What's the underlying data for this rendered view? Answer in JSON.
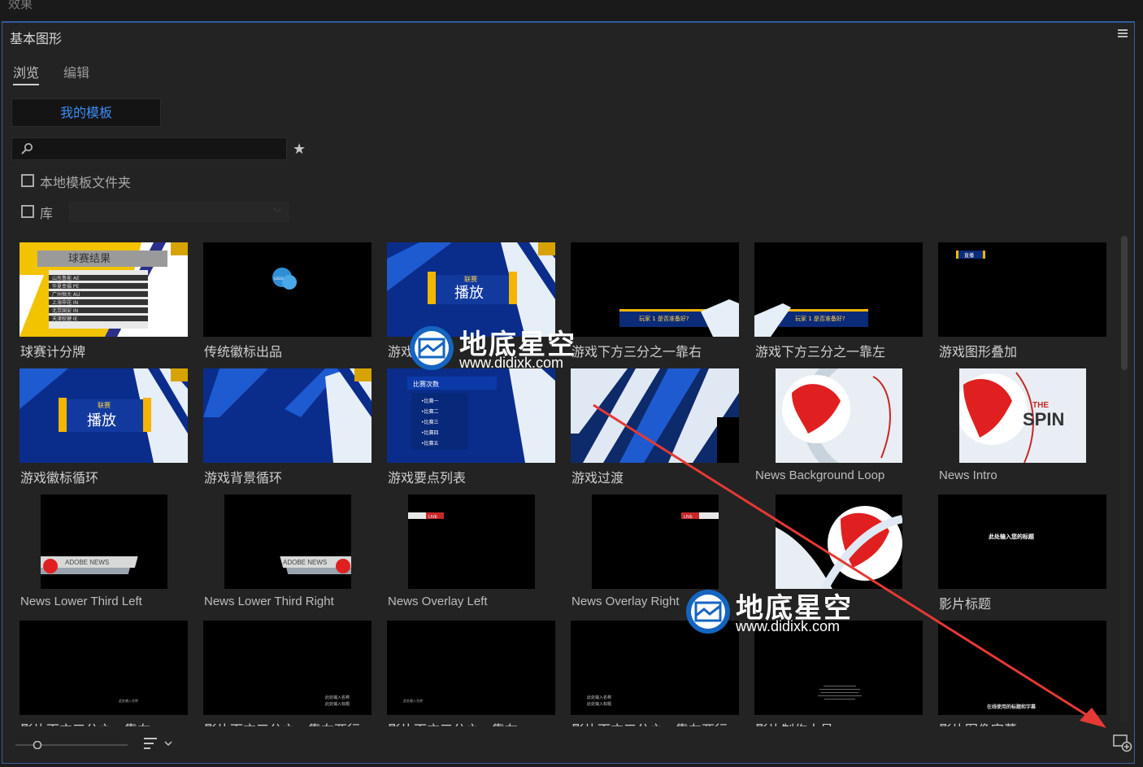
{
  "top_panel_title": "效果",
  "panel": {
    "title": "基本图形"
  },
  "tabs": [
    {
      "label": "浏览"
    },
    {
      "label": "编辑"
    }
  ],
  "my_templates_label": "我的模板",
  "search": {
    "placeholder": ""
  },
  "local_folder_label": "本地模板文件夹",
  "library_label": "库",
  "templates": [
    {
      "caption": "球赛计分牌",
      "thumb_text": [
        "球赛结果",
        "山东鲁能 AE",
        "华夏幸福 PE",
        "广州恒大 AU",
        "上海申花 IN",
        "北京国安 IN",
        "天津权健 IE"
      ]
    },
    {
      "caption": "传统徽标出品",
      "thumb_text": [
        "LOGO"
      ]
    },
    {
      "caption": "游戏徽标",
      "thumb_text": [
        "联赛",
        "播放"
      ]
    },
    {
      "caption": "游戏下方三分之一靠右",
      "thumb_text": [
        "玩家 1 是否准备好?"
      ]
    },
    {
      "caption": "游戏下方三分之一靠左",
      "thumb_text": [
        "玩家 1 是否准备好?"
      ]
    },
    {
      "caption": "游戏图形叠加",
      "thumb_text": [
        "直播"
      ]
    },
    {
      "caption": "游戏徽标循环",
      "thumb_text": [
        "联赛",
        "播放"
      ]
    },
    {
      "caption": "游戏背景循环",
      "thumb_text": []
    },
    {
      "caption": "游戏要点列表",
      "thumb_text": [
        "比赛次数",
        "•比赛一",
        "•比赛二",
        "•比赛三",
        "•比赛四",
        "•比赛五"
      ]
    },
    {
      "caption": "游戏过渡",
      "thumb_text": []
    },
    {
      "caption": "News Background Loop",
      "thumb_text": []
    },
    {
      "caption": "News Intro",
      "thumb_text": [
        "THE",
        "SPIN"
      ]
    },
    {
      "caption": "News Lower Third Left",
      "thumb_text": [
        "ADOBE NEWS"
      ]
    },
    {
      "caption": "News Lower Third Right",
      "thumb_text": [
        "ADOBE NEWS"
      ]
    },
    {
      "caption": "News Overlay Left",
      "thumb_text": [
        "LIVE"
      ]
    },
    {
      "caption": "News Overlay Right",
      "thumb_text": [
        "LIVE"
      ]
    },
    {
      "caption": "",
      "thumb_text": []
    },
    {
      "caption": "影片标题",
      "thumb_text": [
        "此处输入您的标题"
      ]
    },
    {
      "caption": "影片下方三分之一靠右",
      "thumb_text": [
        "此处输入名称"
      ]
    },
    {
      "caption": "影片下方三分之一靠右两行",
      "thumb_text": [
        "此处输入名称",
        "此处输入标题"
      ]
    },
    {
      "caption": "影片下方三分之一靠左",
      "thumb_text": [
        "此处输入名称"
      ]
    },
    {
      "caption": "影片下方三分之一靠左两行",
      "thumb_text": [
        "此处输入名称",
        "此处输入标题"
      ]
    },
    {
      "caption": "影片制作人员",
      "thumb_text": []
    },
    {
      "caption": "影片图像字幕",
      "thumb_text": [
        "在线使用的标题和字幕"
      ]
    }
  ],
  "watermarks": [
    {
      "title": "地底星空",
      "url": "www.didixk.com"
    },
    {
      "title": "地底星空",
      "url": "www.didixk.com"
    }
  ],
  "colors": {
    "accent_blue": "#3d8df5",
    "panel_border": "#2f5b9e",
    "arrow_red": "#e53935"
  }
}
